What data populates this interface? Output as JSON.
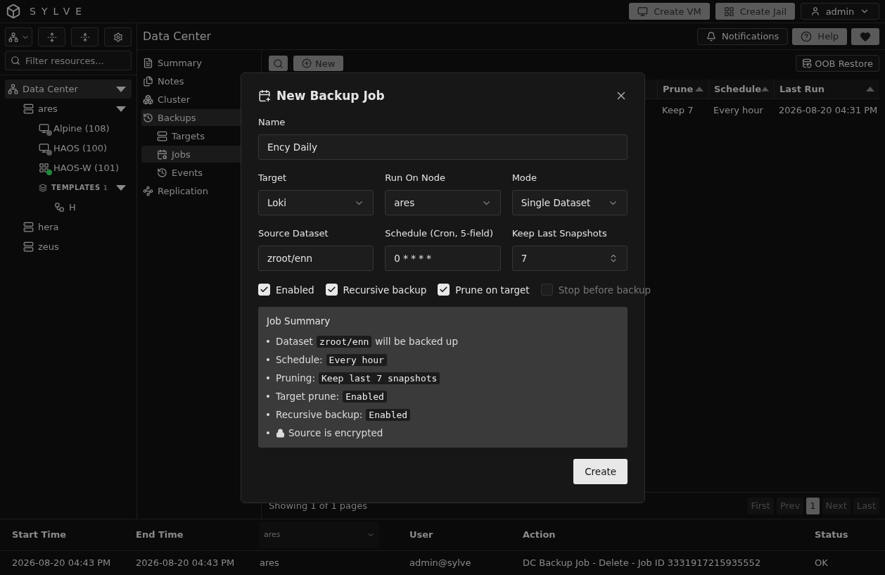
{
  "brand": "SYLVE",
  "header": {
    "buttons": [
      {
        "kind": "vm",
        "label": "Create VM"
      },
      {
        "kind": "jail",
        "label": "Create Jail"
      }
    ],
    "user": "admin"
  },
  "sidebar": {
    "filter_placeholder": "Filter resources...",
    "tree": [
      {
        "kind": "datacenter",
        "label": "Data Center",
        "expanded": true,
        "children": [
          {
            "kind": "node",
            "label": "ares",
            "expanded": true,
            "children": [
              {
                "kind": "vm",
                "label": "Alpine (108)",
                "color": "#5a5a5a"
              },
              {
                "kind": "vm",
                "label": "HAOS (100)",
                "color": "#5a5a5a"
              },
              {
                "kind": "jail",
                "label": "HAOS-W (101)",
                "color": "#1f8a3a"
              },
              {
                "kind": "group",
                "label": "TEMPLATES",
                "count": "1",
                "expanded": true,
                "children": [
                  {
                    "kind": "template",
                    "label": "H"
                  }
                ]
              }
            ]
          },
          {
            "kind": "node",
            "label": "hera"
          },
          {
            "kind": "node",
            "label": "zeus"
          }
        ]
      }
    ]
  },
  "page_title": "Data Center",
  "top_actions": [
    {
      "kind": "bell",
      "label": "Notifications"
    },
    {
      "kind": "help",
      "label": "Help"
    },
    {
      "kind": "heart"
    }
  ],
  "nav": [
    {
      "kind": "summary",
      "label": "Summary",
      "selected": false
    },
    {
      "kind": "notes",
      "label": "Notes",
      "selected": false
    },
    {
      "kind": "cluster",
      "label": "Cluster",
      "selected": false
    },
    {
      "kind": "backups",
      "label": "Backups",
      "selected": true,
      "children": [
        {
          "kind": "targets",
          "label": "Targets",
          "selected": false
        },
        {
          "kind": "jobs",
          "label": "Jobs",
          "selected": true
        },
        {
          "kind": "events",
          "label": "Events",
          "selected": false
        }
      ]
    },
    {
      "kind": "replication",
      "label": "Replication",
      "selected": false
    }
  ],
  "toolbar": {
    "new_label": "New",
    "restore_label": "OOB Restore"
  },
  "table": {
    "columns": [
      "Prune",
      "Schedule",
      "Last Run"
    ],
    "rows": [
      [
        "Keep 7",
        "Every hour",
        "2026-08-20 04:31 PM"
      ]
    ]
  },
  "pagination": {
    "info": "Showing 1 of 1 pages",
    "pages": [
      {
        "label": "First",
        "selected": false
      },
      {
        "label": "Prev",
        "selected": false
      },
      {
        "label": "1",
        "selected": true
      },
      {
        "label": "Next",
        "selected": false
      },
      {
        "label": "Last",
        "selected": false
      }
    ]
  },
  "audit": {
    "columns": [
      {
        "kind": "text",
        "label": "Start Time"
      },
      {
        "kind": "text",
        "label": "End Time"
      },
      {
        "kind": "select",
        "label": "ares"
      },
      {
        "kind": "text",
        "label": "User"
      },
      {
        "kind": "text",
        "label": "Action"
      },
      {
        "kind": "text",
        "label": "Status"
      }
    ],
    "rows": [
      [
        "2026-08-20 04:43 PM",
        "2026-08-20 04:43 PM",
        "ares",
        "admin@sylve",
        "DC Backup Job - Delete - Job ID 3331917215935552",
        "OK"
      ]
    ]
  },
  "dialog": {
    "title": "New Backup Job",
    "name_label": "Name",
    "name_value": "Ency Daily",
    "selects": [
      {
        "label": "Target",
        "value": "Loki"
      },
      {
        "label": "Run On Node",
        "value": "ares"
      },
      {
        "label": "Mode",
        "value": "Single Dataset"
      }
    ],
    "inputs": [
      {
        "kind": "text",
        "label": "Source Dataset",
        "value": "zroot/enn"
      },
      {
        "kind": "text",
        "label": "Schedule (Cron, 5-field)",
        "value": "0 * * * *"
      },
      {
        "kind": "number",
        "label": "Keep Last Snapshots",
        "value": "7"
      }
    ],
    "checkboxes": [
      {
        "label": "Enabled",
        "checked": true
      },
      {
        "label": "Recursive backup",
        "checked": true
      },
      {
        "label": "Prune on target",
        "checked": true
      },
      {
        "label": "Stop before backup",
        "checked": false
      }
    ],
    "summary": {
      "title": "Job Summary",
      "items": [
        {
          "parts": [
            {
              "kind": "text",
              "text": "Dataset"
            },
            {
              "kind": "code",
              "text": "zroot/enn"
            },
            {
              "kind": "text",
              "text": "will be backed up"
            }
          ]
        },
        {
          "parts": [
            {
              "kind": "text",
              "text": "Schedule:"
            },
            {
              "kind": "code",
              "text": "Every hour"
            }
          ]
        },
        {
          "parts": [
            {
              "kind": "text",
              "text": "Pruning:"
            },
            {
              "kind": "code",
              "text": "Keep last 7 snapshots"
            }
          ]
        },
        {
          "parts": [
            {
              "kind": "text",
              "text": "Target prune:"
            },
            {
              "kind": "code",
              "text": "Enabled"
            }
          ]
        },
        {
          "parts": [
            {
              "kind": "text",
              "text": "Recursive backup:"
            },
            {
              "kind": "code",
              "text": "Enabled"
            }
          ]
        },
        {
          "locked": true,
          "parts": [
            {
              "kind": "text",
              "text": "Source is encrypted"
            }
          ]
        }
      ]
    },
    "submit": "Create"
  }
}
